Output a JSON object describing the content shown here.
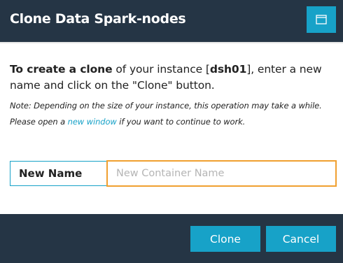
{
  "header": {
    "title": "Clone Data Spark-nodes",
    "maximize_icon": "window-maximize-icon"
  },
  "body": {
    "intro_bold": "To create a clone",
    "intro_part1": " of your instance [",
    "instance_name": "dsh01",
    "intro_part2": "], enter a new name and click on the \"Clone\" button.",
    "note_part1": "Note: Depending on the size of your instance, this operation may take a while. Please open a ",
    "note_link": "new window",
    "note_part2": " if you want to continue to work."
  },
  "form": {
    "label": "New Name",
    "value": "",
    "placeholder": "New Container Name"
  },
  "footer": {
    "clone_label": "Clone",
    "cancel_label": "Cancel"
  },
  "colors": {
    "header_bg": "#253545",
    "accent": "#17a2c8",
    "input_focus_border": "#f0a030"
  }
}
